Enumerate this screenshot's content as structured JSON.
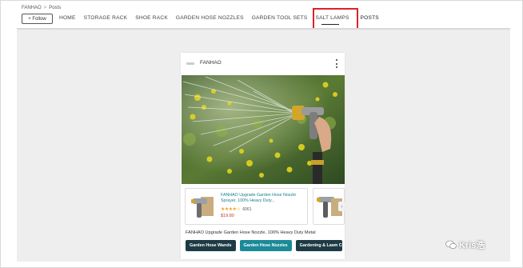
{
  "breadcrumb": {
    "items": [
      "FANHAO",
      "Posts"
    ],
    "separator": ">"
  },
  "follow_button": {
    "label": "+ Follow"
  },
  "nav": {
    "items": [
      {
        "label": "HOME"
      },
      {
        "label": "STORAGE RACK"
      },
      {
        "label": "SHOE RACK"
      },
      {
        "label": "GARDEN HOSE NOZZLES"
      },
      {
        "label": "GARDEN TOOL SETS"
      },
      {
        "label": "SALT LAMPS"
      },
      {
        "label": "POSTS",
        "active": true
      }
    ]
  },
  "post": {
    "brand": "FANHAO",
    "caption": "FANHAO Upgrade Garden Hose Nozzle, 100% Heavy Duty Metal",
    "products": [
      {
        "title": "FANHAO Upgrade Garden Hose Nozzle Sprayer, 100% Heavy Duty...",
        "rating": 4.5,
        "stars": "★★★★☆",
        "rating_count": "6061",
        "price": "$19.80"
      }
    ],
    "tags": [
      {
        "label": "Garden Hose Wands",
        "style": "dark"
      },
      {
        "label": "Garden Hose Nozzles",
        "style": "teal"
      },
      {
        "label": "Gardening & Lawn Care",
        "style": "dark"
      }
    ]
  },
  "watermark": {
    "text": "Kris浩"
  },
  "colors": {
    "highlight": "#d9232a",
    "link": "#1a7e8c",
    "price": "#c0392b",
    "tag_dark": "#1d3b44",
    "tag_teal": "#1a8a98",
    "stars": "#f0a020"
  }
}
